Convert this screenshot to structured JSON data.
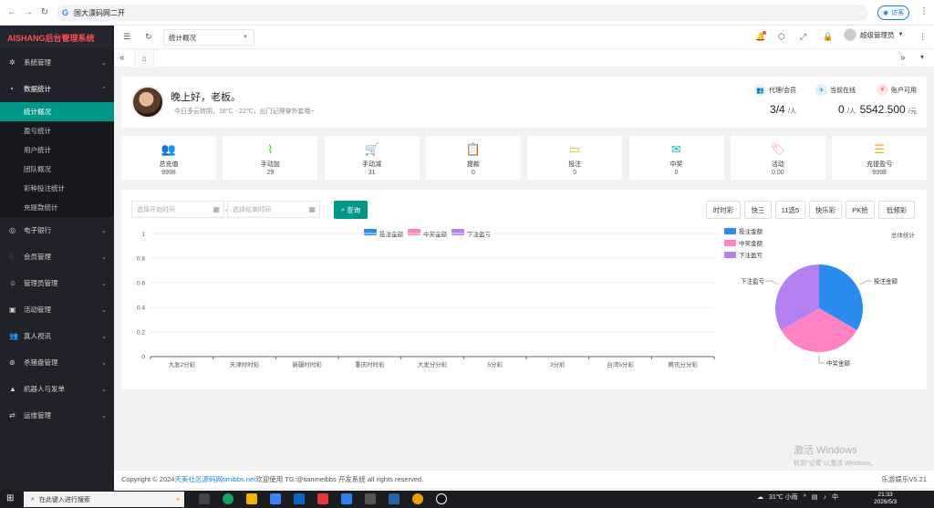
{
  "browser": {
    "url": "国大漂码网二开",
    "visitor_label": "访客"
  },
  "sidebar": {
    "brand": "AISHANG后台管理系统",
    "items": [
      {
        "label": "系统管理",
        "icon": "gear-icon"
      },
      {
        "label": "数据统计",
        "icon": "dashboard-icon",
        "open": true
      },
      {
        "label": "电子银行",
        "icon": "bank-icon"
      },
      {
        "label": "会员管理",
        "icon": "member-icon"
      },
      {
        "label": "管理员管理",
        "icon": "admin-icon"
      },
      {
        "label": "活动管理",
        "icon": "activity-icon"
      },
      {
        "label": "真人视讯",
        "icon": "users-icon"
      },
      {
        "label": "杀猪盘管理",
        "icon": "settings-icon"
      },
      {
        "label": "机器人与发单",
        "icon": "robot-icon"
      },
      {
        "label": "运维管理",
        "icon": "ops-icon"
      }
    ],
    "submenu": [
      "统计概况",
      "盈亏统计",
      "用户统计",
      "团队概况",
      "彩种投注统计",
      "充提款统计"
    ]
  },
  "topbar": {
    "select_value": "统计概况",
    "admin_name": "超级管理员"
  },
  "welcome": {
    "greeting": "晚上好，老板。",
    "weather": "今日多云转阴，18℃ - 22℃，出门记得穿外套哦~",
    "stats": [
      {
        "label": "代理/会员",
        "value": "3/4",
        "unit": "/人",
        "color": "#52c41a"
      },
      {
        "label": "当前在线",
        "value": "0",
        "unit": "/人",
        "color": "#1890ff"
      },
      {
        "label": "账户可用",
        "value": "5542.500",
        "unit": "/元",
        "color": "#ff4d4f"
      }
    ]
  },
  "cards": [
    {
      "label": "总充值",
      "value": "9998",
      "icon": "users-icon",
      "color": "#5b9bd5"
    },
    {
      "label": "手动加",
      "value": "29",
      "icon": "pulse-icon",
      "color": "#52c41a"
    },
    {
      "label": "手动减",
      "value": "31",
      "icon": "cart-icon",
      "color": "#ff7a45"
    },
    {
      "label": "提款",
      "value": "0",
      "icon": "clipboard-icon",
      "color": "#9254de"
    },
    {
      "label": "投注",
      "value": "0",
      "icon": "card-icon",
      "color": "#faad14"
    },
    {
      "label": "中奖",
      "value": "0",
      "icon": "mail-icon",
      "color": "#13c2c2"
    },
    {
      "label": "活动",
      "value": "0.00",
      "icon": "tag-icon",
      "color": "#ff85c0"
    },
    {
      "label": "充提盈亏",
      "value": "9998",
      "icon": "sliders-icon",
      "color": "#faad14"
    }
  ],
  "filters": {
    "start_placeholder": "选择开始时间",
    "end_placeholder": "选择结束时间",
    "separator": "-",
    "query_label": "查询",
    "game_buttons": [
      "时时彩",
      "快三",
      "11选5",
      "快乐彩",
      "PK拾",
      "低频彩"
    ]
  },
  "chart_data": [
    {
      "type": "bar",
      "categories": [
        "大发2分彩",
        "天津时时彩",
        "新疆时时彩",
        "重庆时时彩",
        "大发分分彩",
        "5分彩",
        "3分彩",
        "台湾5分彩",
        "腾讯分分彩"
      ],
      "series": [
        {
          "name": "投注金额",
          "color": "#2b8cf0",
          "values": [
            0,
            0,
            0,
            0,
            0,
            0,
            0,
            0,
            0
          ]
        },
        {
          "name": "中奖金额",
          "color": "#ff82c3",
          "values": [
            0,
            0,
            0,
            0,
            0,
            0,
            0,
            0,
            0
          ]
        },
        {
          "name": "下注盈亏",
          "color": "#b47ff0",
          "values": [
            0,
            0,
            0,
            0,
            0,
            0,
            0,
            0,
            0
          ]
        }
      ],
      "yticks": [
        "0",
        "0.2",
        "0.4",
        "0.6",
        "0.8",
        "1"
      ],
      "ylim": [
        0,
        1
      ],
      "legend": "top-center"
    },
    {
      "type": "pie",
      "title": "总体统计",
      "slices": [
        {
          "name": "投注金额",
          "value": 1,
          "color": "#2b8cf0"
        },
        {
          "name": "中奖金额",
          "value": 1,
          "color": "#ff82c3"
        },
        {
          "name": "下注盈亏",
          "value": 1,
          "color": "#b47ff0"
        }
      ],
      "legend": "top-left"
    }
  ],
  "footer": {
    "prefix": "Copyright © 2024 ",
    "link": "天美社区源码网timibbs.net",
    "suffix": " 欢迎使用 TG:@tianmeibbs 开发系统 all rights reserved.",
    "version": "乐游娱乐V5.21"
  },
  "watermark": {
    "line1": "激活 Windows",
    "line2": "转到\"设置\"以激活 Windows。"
  },
  "taskbar": {
    "search_placeholder": "在此键入进行搜索",
    "weather": "31℃ 小雨",
    "ime": "中",
    "time": "21:33",
    "date": "2026/5/3"
  }
}
